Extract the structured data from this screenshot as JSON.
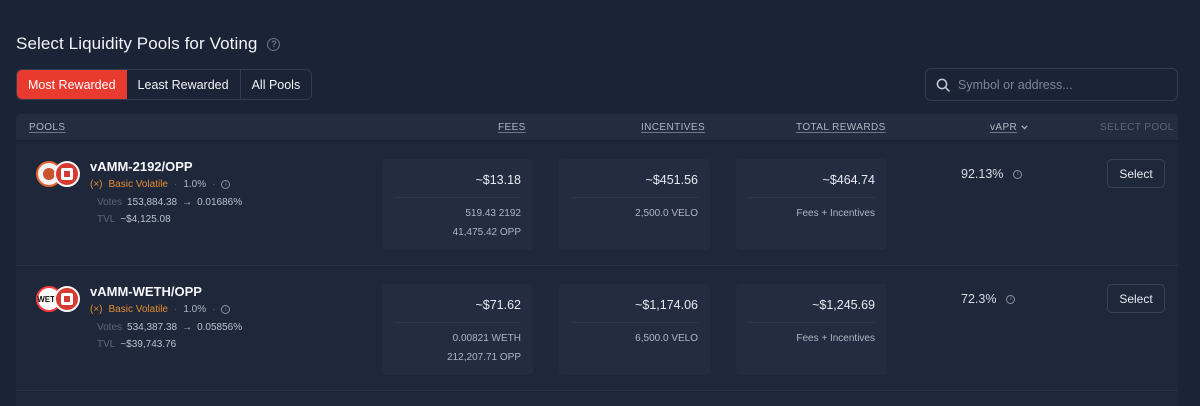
{
  "header": {
    "title": "Select Liquidity Pools for Voting"
  },
  "tabs": [
    {
      "label": "Most Rewarded",
      "active": true
    },
    {
      "label": "Least Rewarded",
      "active": false
    },
    {
      "label": "All Pools",
      "active": false
    }
  ],
  "search": {
    "placeholder": "Symbol or address..."
  },
  "columns": {
    "pools": "POOLS",
    "fees": "FEES",
    "incentives": "INCENTIVES",
    "total_rewards": "TOTAL REWARDS",
    "vapr": "vAPR",
    "select_pool": "SELECT POOL"
  },
  "pools": [
    {
      "name": "vAMM-2192/OPP",
      "type": "Basic Volatile",
      "fee": "1.0%",
      "votes_label": "Votes",
      "votes": "153,884.38",
      "votes_pct": "0.01686%",
      "tvl_label": "TVL",
      "tvl": "~$4,125.08",
      "fees_total": "~$13.18",
      "fees_token1": "519.43 2192",
      "fees_token2": "41,475.42 OPP",
      "incentives_total": "~$451.56",
      "incentives_token": "2,500.0 VELO",
      "total_rewards": "~$464.74",
      "total_rewards_note": "Fees + Incentives",
      "vapr": "92.13%",
      "select_label": "Select"
    },
    {
      "name": "vAMM-WETH/OPP",
      "type": "Basic Volatile",
      "fee": "1.0%",
      "votes_label": "Votes",
      "votes": "534,387.38",
      "votes_pct": "0.05856%",
      "tvl_label": "TVL",
      "tvl": "~$39,743.76",
      "fees_total": "~$71.62",
      "fees_token1": "0.00821 WETH",
      "fees_token2": "212,207.71 OPP",
      "incentives_total": "~$1,174.06",
      "incentives_token": "6,500.0 VELO",
      "total_rewards": "~$1,245.69",
      "total_rewards_note": "Fees + Incentives",
      "vapr": "72.3%",
      "select_label": "Select"
    }
  ],
  "colors": {
    "background": "#1b2336",
    "accent": "#e83a2f",
    "pool_type": "#e58b2e"
  }
}
